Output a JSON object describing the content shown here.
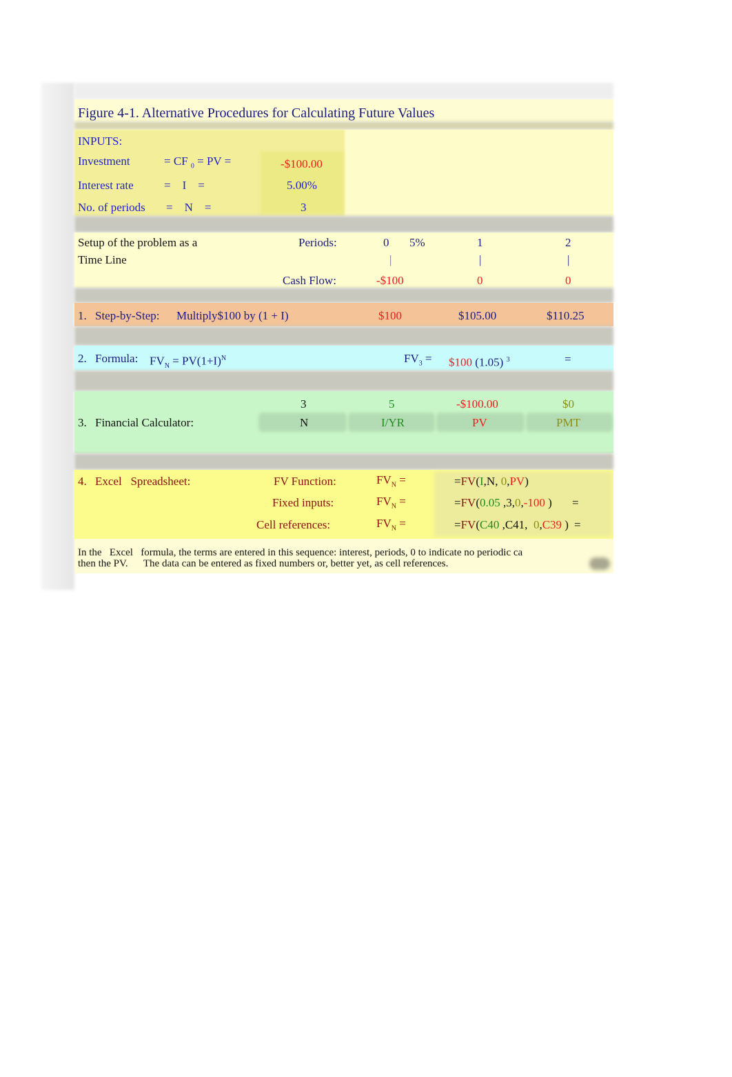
{
  "title": "Figure 4-1.     Alternative Procedures for Calculating Future Values",
  "inputs": {
    "heading": "INPUTS:",
    "rows": [
      {
        "label": "Investment",
        "eq": "= CF",
        "eq_sub": "0",
        "eq_tail": " = PV =",
        "value": "-$100.00"
      },
      {
        "label": "Interest rate",
        "eq": "=    I    =",
        "value": "5.00%"
      },
      {
        "label": "No. of periods",
        "eq": "=    N    =",
        "value": "3"
      }
    ]
  },
  "timeline": {
    "label_line1": "Setup of the problem as a",
    "label_line2": "Time Line",
    "periods_label": "Periods:",
    "periods": [
      "0",
      "1",
      "2"
    ],
    "rate": "5%",
    "tick": "|",
    "cashflow_label": "Cash Flow:",
    "cashflows": [
      "-$100",
      "0",
      "0"
    ]
  },
  "step1": {
    "number": "1.",
    "label": "Step-by-Step:",
    "desc": "Multiply$100 by (1 + I)",
    "values": [
      "$100",
      "$105.00",
      "$110.25"
    ]
  },
  "step2": {
    "number": "2.",
    "label": "Formula:",
    "formula_fv": "FV",
    "formula_sub": "N",
    "formula_rest": " = PV(1+I)",
    "formula_sup": "N",
    "fv3": "FV",
    "fv3_sub": "3",
    "fv3_eq": " =",
    "pv": "$100",
    "factor": "(1.05)",
    "exp": "3",
    "result_eq": "="
  },
  "step3": {
    "number": "3.",
    "label": "Financial Calculator:",
    "keys": [
      {
        "value": "3",
        "key": "N"
      },
      {
        "value": "5",
        "key": "I/YR"
      },
      {
        "value": "-$100.00",
        "key": "PV"
      },
      {
        "value": "$0",
        "key": "PMT"
      }
    ]
  },
  "step4": {
    "number": "4.",
    "label": "Excel   Spreadsheet:",
    "rows": [
      {
        "label": "FV Function:",
        "fv": "FV",
        "sub": "N",
        "eq": " =",
        "parts": [
          "=",
          "FV",
          "(",
          "I",
          ",N, ",
          "0",
          ",",
          "PV",
          ")"
        ],
        "tail": ""
      },
      {
        "label": "Fixed inputs:",
        "fv": "FV",
        "sub": "N",
        "eq": " =",
        "parts": [
          "=",
          "FV",
          "(",
          "0.05",
          " ,3,",
          "0",
          ",",
          "-100",
          " )"
        ],
        "tail": "="
      },
      {
        "label": "Cell references:",
        "fv": "FV",
        "sub": "N",
        "eq": " =",
        "parts": [
          "=",
          "FV",
          "(",
          "C40",
          " ,C41,  ",
          "0",
          ",",
          "C39",
          " )"
        ],
        "tail": "="
      }
    ]
  },
  "note": {
    "line1": "In the   Excel   formula, the terms are entered in this sequence: interest, periods, 0 to indicate no periodic ca",
    "line2": "then the PV.      The data can be entered as fixed numbers or, better yet, as cell references."
  }
}
